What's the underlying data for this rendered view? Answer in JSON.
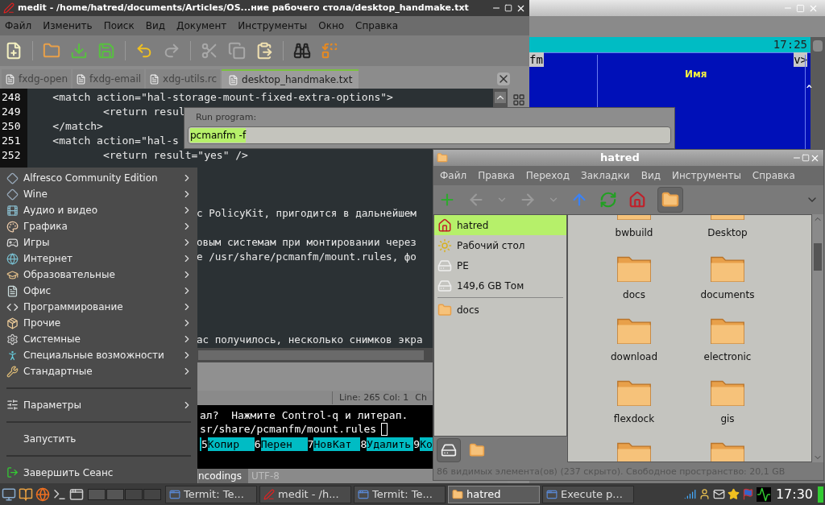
{
  "background_window": {
    "clock": "17:25",
    "left_label": "fm",
    "right_label": "v>",
    "column_header": "Имя",
    "scroll_mark": "^"
  },
  "editor_window": {
    "title": "medit - /home/hatred/documents/Articles/OS...ние рабочего стола/desktop_handmake.txt",
    "menu": [
      "Файл",
      "Изменить",
      "Поиск",
      "Вид",
      "Документ",
      "Инструменты",
      "Окно",
      "Справка"
    ],
    "toolbar": [
      {
        "kind": "new",
        "disabled": false
      },
      {
        "kind": "open",
        "disabled": false
      },
      {
        "kind": "save",
        "disabled": false
      },
      {
        "kind": "save_as",
        "disabled": false
      },
      {
        "kind": "undo",
        "disabled": false
      },
      {
        "kind": "redo",
        "disabled": true
      },
      {
        "kind": "cut",
        "disabled": true
      },
      {
        "kind": "copy",
        "disabled": true
      },
      {
        "kind": "paste",
        "disabled": false
      },
      {
        "kind": "find",
        "disabled": false
      },
      {
        "kind": "replace",
        "disabled": false
      }
    ],
    "tabs": [
      {
        "label": "fxdg-open",
        "selected": false
      },
      {
        "label": "fxdg-email",
        "selected": false
      },
      {
        "label": "xdg-utils.rc",
        "selected": false
      },
      {
        "label": "desktop_handmake.txt",
        "selected": true
      }
    ],
    "code_lines": [
      {
        "number": "248",
        "text": "    <match action=\"hal-storage-mount-fixed-extra-options\">"
      },
      {
        "number": "249",
        "text": "            <return resul"
      },
      {
        "number": "250",
        "text": "    </match>"
      },
      {
        "number": "251",
        "text": "    <match action=\"hal-s"
      },
      {
        "number": "252",
        "text": "            <return result=\"yes\" />"
      }
    ],
    "text_fragments": [
      "с PolicyKit, пригодится в дальнейшем",
      "овым системам при монтировании через",
      "е /usr/share/pcmanfm/mount.rules, фо",
      "ас получилось, несколько снимков экра"
    ],
    "status": {
      "position": "Line: 265 Col: 1",
      "column_2": "Ch"
    },
    "terminal_lines": [
      "ал?  Нажмите Control-q и литерап.",
      "sr/share/pcmanfm/mount.rules"
    ],
    "function_keys": [
      {
        "number": "5",
        "label": "Копир"
      },
      {
        "number": "6",
        "label": "Перен"
      },
      {
        "number": "7",
        "label": "НовКат"
      },
      {
        "number": "8",
        "label": "Удалить"
      },
      {
        "number": "9",
        "label": "Ко"
      }
    ],
    "encoding_bar": {
      "label": "ncodings",
      "value": "UTF-8"
    }
  },
  "run_dialog": {
    "label": "Run program:",
    "value": "pcmanfm -f"
  },
  "file_manager": {
    "title": "hatred",
    "menu": [
      "Файл",
      "Правка",
      "Переход",
      "Закладки",
      "Вид",
      "Инструменты",
      "Справка"
    ],
    "toolbar": [
      {
        "kind": "new_tab",
        "disabled": false
      },
      {
        "kind": "back",
        "disabled": true
      },
      {
        "kind": "dropdown",
        "disabled": true
      },
      {
        "kind": "forward",
        "disabled": true
      },
      {
        "kind": "dropdown",
        "disabled": true
      },
      {
        "kind": "up",
        "disabled": false
      },
      {
        "kind": "reload",
        "disabled": false
      },
      {
        "kind": "home",
        "disabled": false
      },
      {
        "kind": "folder",
        "disabled": false
      }
    ],
    "places": [
      {
        "kind": "home",
        "label": "hatred",
        "selected": true
      },
      {
        "kind": "desktop",
        "label": "Рабочий стол",
        "selected": false
      },
      {
        "kind": "drive",
        "label": "PE",
        "selected": false
      },
      {
        "kind": "drive",
        "label": "149,6 GB Том",
        "selected": false
      }
    ],
    "bookmarks": [
      {
        "label": "docs",
        "selected": false
      }
    ],
    "side_tabs": [
      {
        "kind": "places",
        "selected": true
      },
      {
        "kind": "tree",
        "selected": false
      }
    ],
    "files": [
      {
        "label": "bwbuild"
      },
      {
        "label": "Desktop"
      },
      {
        "label": "docs"
      },
      {
        "label": "documents"
      },
      {
        "label": "download"
      },
      {
        "label": "electronic"
      },
      {
        "label": "flexdock"
      },
      {
        "label": "gis"
      }
    ],
    "status": "86 видимых элемента(ов) (237 скрыто). Свободное пространство: 20,1 GB"
  },
  "app_menu": {
    "items": [
      {
        "kind": "submenu",
        "label": "Alfresco Community Edition"
      },
      {
        "kind": "submenu",
        "label": "Wine"
      },
      {
        "kind": "submenu",
        "label": "Аудио и видео"
      },
      {
        "kind": "submenu",
        "label": "Графика"
      },
      {
        "kind": "submenu",
        "label": "Игры"
      },
      {
        "kind": "submenu",
        "label": "Интернет"
      },
      {
        "kind": "submenu",
        "label": "Образовательные"
      },
      {
        "kind": "submenu",
        "label": "Офис"
      },
      {
        "kind": "submenu",
        "label": "Программирование"
      },
      {
        "kind": "submenu",
        "label": "Прочие"
      },
      {
        "kind": "submenu",
        "label": "Системные"
      },
      {
        "kind": "submenu",
        "label": "Специальные возможности"
      },
      {
        "kind": "submenu",
        "label": "Стандартные"
      },
      {
        "kind": "separator"
      },
      {
        "kind": "submenu",
        "label": "Параметры"
      },
      {
        "kind": "separator"
      },
      {
        "kind": "action",
        "label": "Запустить"
      },
      {
        "kind": "separator"
      },
      {
        "kind": "action",
        "label": "Завершить Сеанс"
      }
    ]
  },
  "taskbar": {
    "tasks": [
      {
        "kind": "terminal",
        "label": "Termit: Te...",
        "selected": false
      },
      {
        "kind": "editor",
        "label": "medit - /h...",
        "selected": false
      },
      {
        "kind": "terminal",
        "label": "Termit: Te...",
        "selected": false
      },
      {
        "kind": "folder",
        "label": "hatred",
        "selected": true
      },
      {
        "kind": "terminal",
        "label": "Execute p...",
        "selected": false
      }
    ],
    "clock": "17:30"
  }
}
